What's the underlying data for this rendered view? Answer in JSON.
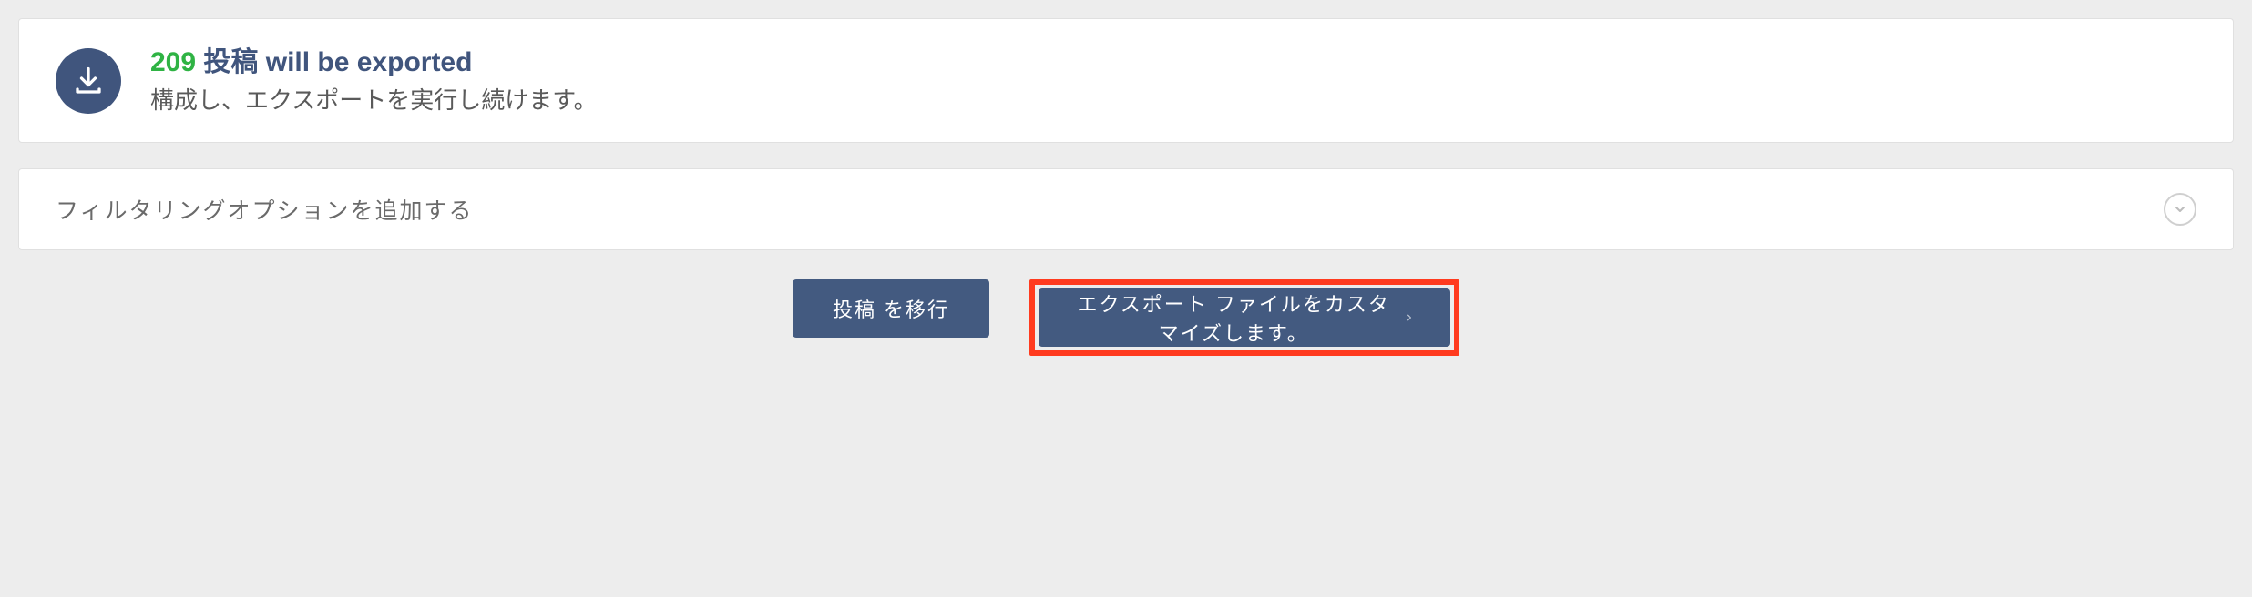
{
  "summary": {
    "count": "209",
    "title_after_count": " 投稿 will be exported",
    "subtitle": "構成し、エクスポートを実行し続けます。"
  },
  "filter": {
    "label": "フィルタリングオプションを追加する"
  },
  "buttons": {
    "migrate": "投稿 を移行",
    "customize": "エクスポート ファイルをカスタマイズします。"
  }
}
